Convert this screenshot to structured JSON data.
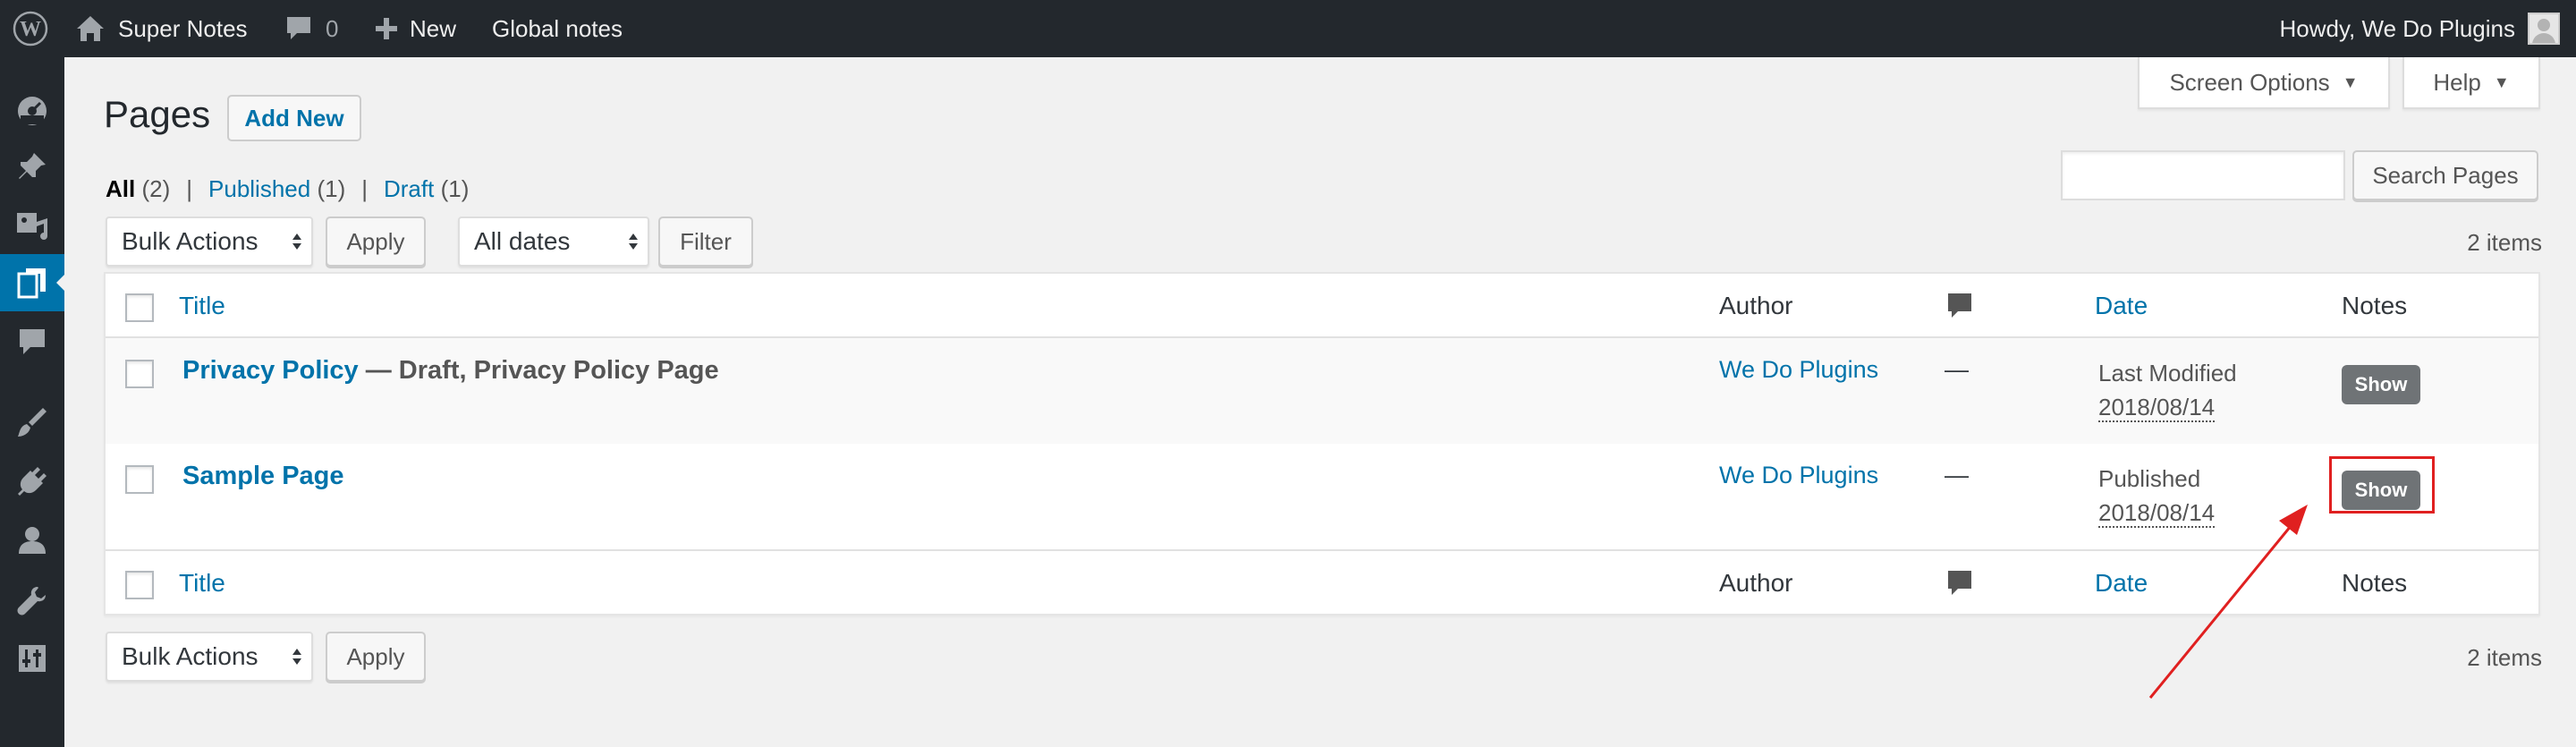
{
  "adminbar": {
    "site_name": "Super Notes",
    "comments_count": "0",
    "new_label": "New",
    "global_notes": "Global notes",
    "howdy": "Howdy, We Do Plugins"
  },
  "sidebar": {
    "icons": [
      "dashboard-icon",
      "pin-icon",
      "media-icon",
      "pages-icon",
      "comments-icon",
      "appearance-icon",
      "plugins-icon",
      "users-icon",
      "tools-icon",
      "settings-icon"
    ],
    "active": "pages-icon",
    "accent": "#0073aa"
  },
  "screen_meta": {
    "screen_options": "Screen Options",
    "help": "Help"
  },
  "page": {
    "title": "Pages",
    "add_new": "Add New"
  },
  "filters": {
    "all": "All",
    "all_count": "(2)",
    "published": "Published",
    "published_count": "(1)",
    "draft": "Draft",
    "draft_count": "(1)",
    "separator": "|"
  },
  "search": {
    "value": "",
    "button": "Search Pages"
  },
  "top_nav": {
    "bulk_actions": "Bulk Actions",
    "apply": "Apply",
    "all_dates": "All dates",
    "filter": "Filter",
    "items": "2 items"
  },
  "bottom_nav": {
    "bulk_actions": "Bulk Actions",
    "apply": "Apply",
    "items": "2 items"
  },
  "table": {
    "columns": {
      "title": "Title",
      "author": "Author",
      "date": "Date",
      "notes": "Notes"
    },
    "rows": [
      {
        "title": "Privacy Policy",
        "state": "— Draft, Privacy Policy Page",
        "author": "We Do Plugins",
        "comments": "—",
        "date_status": "Last Modified",
        "date": "2018/08/14",
        "notes_button": "Show"
      },
      {
        "title": "Sample Page",
        "state": "",
        "author": "We Do Plugins",
        "comments": "—",
        "date_status": "Published",
        "date": "2018/08/14",
        "notes_button": "Show"
      }
    ]
  },
  "annotation": {
    "color": "#e02020"
  }
}
